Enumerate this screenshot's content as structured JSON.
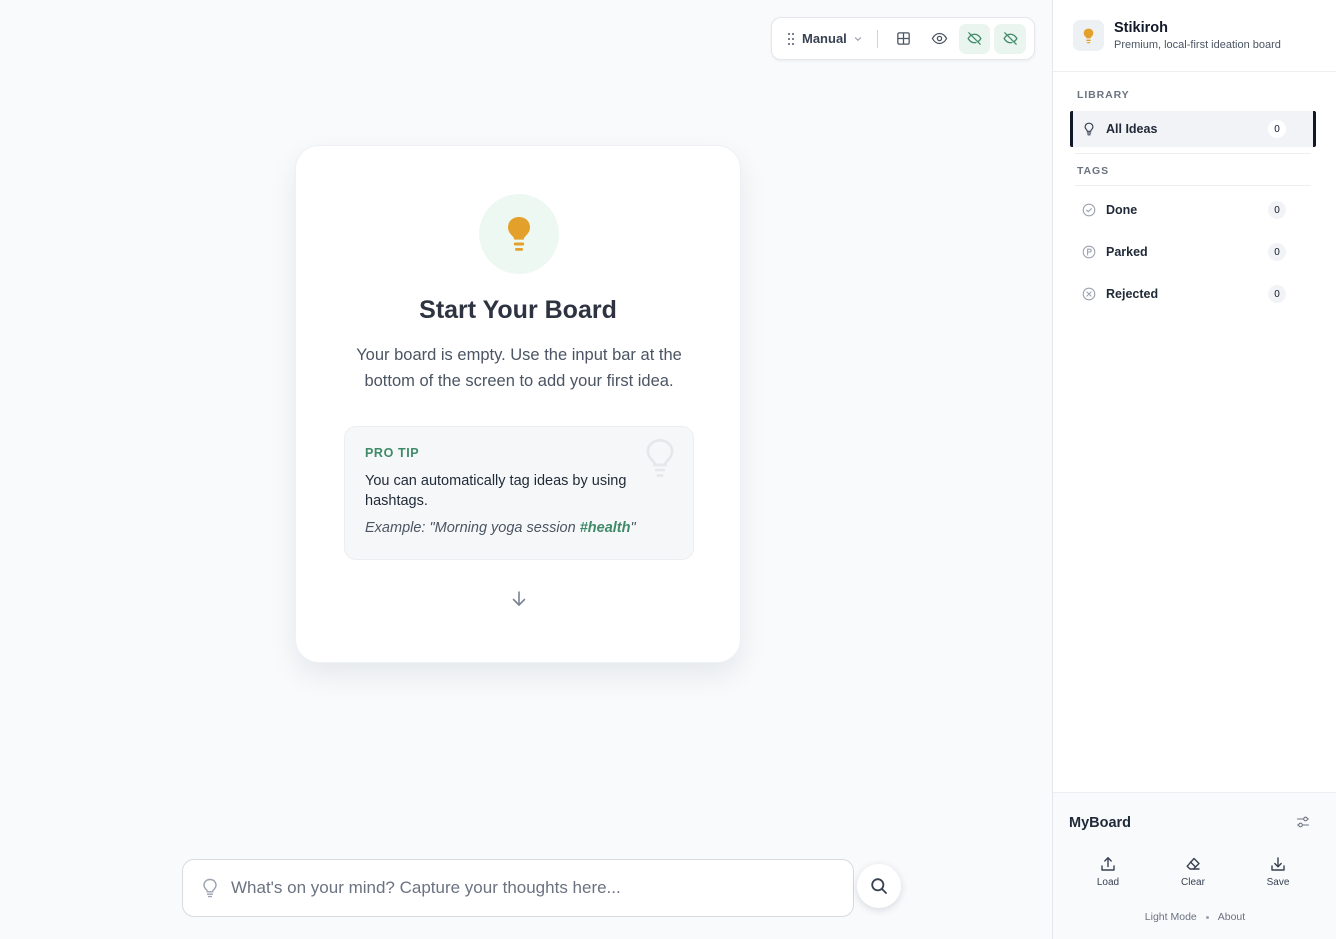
{
  "toolbar": {
    "sort_label": "Manual",
    "icons": [
      "grip-icon",
      "chevron-down-icon",
      "grid-icon",
      "eye-icon",
      "eye-off-icon",
      "eye-off-icon"
    ]
  },
  "empty_state": {
    "title": "Start Your Board",
    "description": "Your board is empty. Use the input bar at the bottom of the screen to add your first idea.",
    "tip_label": "PRO TIP",
    "tip_text": "You can automatically tag ideas by using hashtags.",
    "tip_example_prefix": "Example: \"Morning yoga session ",
    "tip_example_tag": "#health",
    "tip_example_suffix": "\""
  },
  "input": {
    "placeholder": "What's on your mind? Capture your thoughts here...",
    "value": ""
  },
  "sidebar": {
    "app_name": "Stikiroh",
    "tagline": "Premium, local-first ideation board",
    "library_label": "LIBRARY",
    "library_items": [
      {
        "label": "All Ideas",
        "count": "0",
        "icon": "lightbulb-icon"
      }
    ],
    "tags_label": "TAGS",
    "tag_items": [
      {
        "label": "Done",
        "count": "0",
        "icon": "check-circle-icon"
      },
      {
        "label": "Parked",
        "count": "0",
        "icon": "parked-circle-icon"
      },
      {
        "label": "Rejected",
        "count": "0",
        "icon": "x-circle-icon"
      }
    ]
  },
  "footer": {
    "board_name": "MyBoard",
    "load_label": "Load",
    "clear_label": "Clear",
    "save_label": "Save",
    "light_mode_label": "Light Mode",
    "about_label": "About"
  },
  "colors": {
    "accent_green": "#3f8a68",
    "bulb_amber": "#e3a02a",
    "active_toggle_bg": "#eaf5f0"
  }
}
